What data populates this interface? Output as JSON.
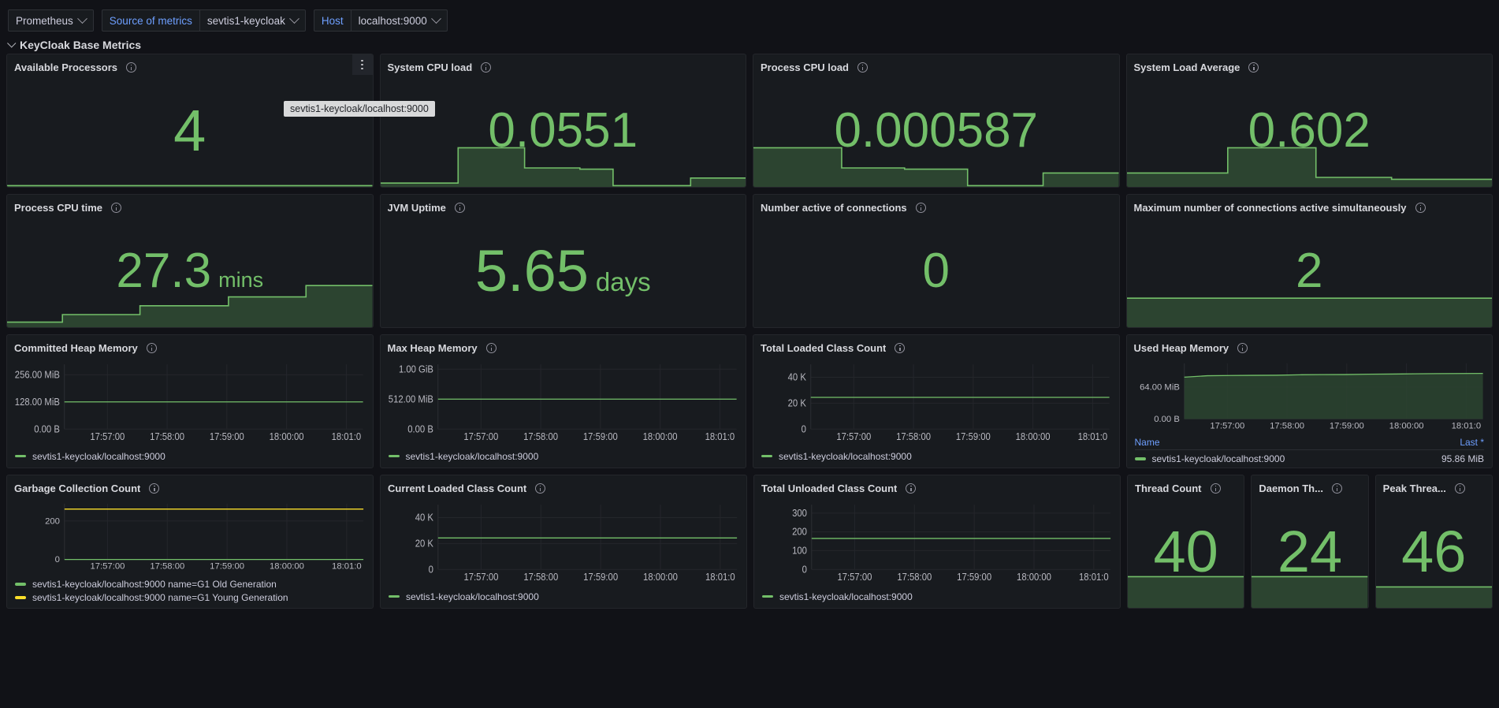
{
  "colors": {
    "green": "#73bf69",
    "green_fill": "#2c4430",
    "yellow": "#fade2a",
    "accent_blue": "#6e9fff",
    "panel_bg": "#181b1f",
    "page_bg": "#111217"
  },
  "varbar": {
    "datasource": "Prometheus",
    "source_label": "Source of metrics",
    "source_value": "sevtis1-keycloak",
    "host_label": "Host",
    "host_value": "localhost:9000"
  },
  "row": {
    "title": "KeyCloak Base Metrics"
  },
  "tooltip": {
    "text": "sevtis1-keycloak/localhost:9000"
  },
  "series_label": "sevtis1-keycloak/localhost:9000",
  "stats": [
    {
      "title": "Available Processors",
      "value": "4",
      "unit": "",
      "size": "big",
      "has_menu": true,
      "sparkline": [
        0.02,
        0.02,
        0.02,
        0.02,
        0.02,
        0.02,
        0.02,
        0.02,
        0.02,
        0.02,
        0.02,
        0.02,
        0.02,
        0.02,
        0.02,
        0.02,
        0.02,
        0.02,
        0.02,
        0.02
      ]
    },
    {
      "title": "System CPU load",
      "value": "0.0551",
      "unit": "",
      "size": "normal",
      "has_menu": false,
      "sparkline": [
        0.06,
        0.06,
        0.06,
        0.06,
        0.06,
        0.06,
        0.06,
        0.62,
        0.62,
        0.62,
        0.62,
        0.62,
        0.62,
        0.3,
        0.3,
        0.3,
        0.3,
        0.3,
        0.28,
        0.28,
        0.28,
        0.02,
        0.02,
        0.02,
        0.02,
        0.02,
        0.02,
        0.02,
        0.14,
        0.14,
        0.14,
        0.14,
        0.14,
        0.14
      ]
    },
    {
      "title": "Process CPU load",
      "value": "0.000587",
      "unit": "",
      "size": "normal",
      "has_menu": false,
      "sparkline": [
        0.62,
        0.62,
        0.62,
        0.62,
        0.62,
        0.62,
        0.62,
        0.3,
        0.3,
        0.3,
        0.3,
        0.3,
        0.28,
        0.28,
        0.28,
        0.28,
        0.28,
        0.02,
        0.02,
        0.02,
        0.02,
        0.02,
        0.02,
        0.22,
        0.22,
        0.22,
        0.22,
        0.22,
        0.22,
        0.22
      ]
    },
    {
      "title": "System Load Average",
      "value": "0.602",
      "unit": "",
      "size": "normal",
      "has_menu": false,
      "sparkline": [
        0.22,
        0.22,
        0.22,
        0.22,
        0.22,
        0.22,
        0.22,
        0.22,
        0.62,
        0.62,
        0.62,
        0.62,
        0.62,
        0.62,
        0.62,
        0.15,
        0.15,
        0.15,
        0.15,
        0.15,
        0.15,
        0.12,
        0.12,
        0.12,
        0.12,
        0.12,
        0.12,
        0.12,
        0.12,
        0.12
      ]
    },
    {
      "title": "Process CPU time",
      "value": "27.3",
      "unit": "mins",
      "size": "normal",
      "has_menu": false,
      "sparkline": [
        0.08,
        0.08,
        0.08,
        0.08,
        0.08,
        0.2,
        0.2,
        0.2,
        0.2,
        0.2,
        0.2,
        0.2,
        0.34,
        0.34,
        0.34,
        0.34,
        0.34,
        0.34,
        0.34,
        0.34,
        0.48,
        0.48,
        0.48,
        0.48,
        0.48,
        0.48,
        0.48,
        0.66,
        0.66,
        0.66,
        0.66,
        0.66,
        0.66,
        0.66
      ]
    },
    {
      "title": "JVM Uptime",
      "value": "5.65",
      "unit": "days",
      "size": "big",
      "has_menu": false,
      "sparkline": []
    },
    {
      "title": "Number active of connections",
      "value": "0",
      "unit": "",
      "size": "normal",
      "has_menu": false,
      "sparkline": []
    },
    {
      "title": "Maximum number of connections active simultaneously",
      "value": "2",
      "unit": "",
      "size": "normal",
      "has_menu": false,
      "sparkline": [
        0.46,
        0.46,
        0.46,
        0.46,
        0.46,
        0.46,
        0.46,
        0.46,
        0.46,
        0.46,
        0.46,
        0.46,
        0.46,
        0.46,
        0.46,
        0.46,
        0.46,
        0.46,
        0.46,
        0.46
      ]
    },
    {
      "title": "Thread Count",
      "value": "40",
      "unit": "",
      "size": "big",
      "has_menu": false,
      "sparkline": [
        0.52,
        0.52,
        0.52,
        0.52,
        0.52,
        0.52,
        0.52,
        0.52,
        0.52,
        0.52,
        0.52,
        0.52,
        0.52,
        0.52,
        0.52,
        0.52,
        0.52,
        0.52,
        0.52,
        0.52
      ]
    },
    {
      "title": "Daemon Th...",
      "value": "24",
      "unit": "",
      "size": "big",
      "has_menu": false,
      "sparkline": [
        0.52,
        0.52,
        0.52,
        0.52,
        0.52,
        0.52,
        0.52,
        0.52,
        0.52,
        0.52,
        0.52,
        0.52,
        0.52,
        0.52,
        0.52,
        0.52,
        0.52,
        0.52,
        0.52,
        0.52
      ]
    },
    {
      "title": "Peak Threa...",
      "value": "46",
      "unit": "",
      "size": "big",
      "has_menu": false,
      "sparkline": [
        0.35,
        0.35,
        0.35,
        0.35,
        0.35,
        0.35,
        0.35,
        0.35,
        0.35,
        0.35,
        0.35,
        0.35,
        0.35,
        0.35,
        0.35,
        0.35,
        0.35,
        0.35,
        0.35,
        0.35
      ]
    }
  ],
  "chart_data": [
    {
      "id": "committed-heap-memory",
      "type": "line",
      "title": "Committed Heap Memory",
      "xlabel": "",
      "ylabel": "",
      "grid": true,
      "legend_position": "bottom",
      "ytick_labels": [
        "256.00 MiB",
        "128.00 MiB",
        "0.00 B"
      ],
      "ytick_values": [
        268435456,
        134217728,
        0
      ],
      "ylim": [
        0,
        320000000
      ],
      "xtick_labels": [
        "17:57:00",
        "17:58:00",
        "17:59:00",
        "18:00:00",
        "18:01:0"
      ],
      "series": [
        {
          "name": "sevtis1-keycloak/localhost:9000",
          "color": "#73bf69",
          "fill": false,
          "values": [
            134217728,
            134217728,
            134217728,
            134217728,
            134217728,
            134217728,
            134217728,
            134217728,
            134217728,
            134217728
          ]
        }
      ]
    },
    {
      "id": "max-heap-memory",
      "type": "line",
      "title": "Max Heap Memory",
      "xlabel": "",
      "ylabel": "",
      "grid": true,
      "legend_position": "bottom",
      "ytick_labels": [
        "1.00 GiB",
        "512.00 MiB",
        "0.00 B"
      ],
      "ytick_values": [
        1073741824,
        536870912,
        0
      ],
      "ylim": [
        0,
        1160000000
      ],
      "xtick_labels": [
        "17:57:00",
        "17:58:00",
        "17:59:00",
        "18:00:00",
        "18:01:0"
      ],
      "series": [
        {
          "name": "sevtis1-keycloak/localhost:9000",
          "color": "#73bf69",
          "fill": false,
          "values": [
            536870912,
            536870912,
            536870912,
            536870912,
            536870912,
            536870912,
            536870912,
            536870912,
            536870912,
            536870912
          ]
        }
      ]
    },
    {
      "id": "total-loaded-class-count",
      "type": "line",
      "title": "Total Loaded Class Count",
      "xlabel": "",
      "ylabel": "",
      "grid": true,
      "legend_position": "bottom",
      "ytick_labels": [
        "40 K",
        "20 K",
        "0"
      ],
      "ytick_values": [
        40000,
        20000,
        0
      ],
      "ylim": [
        0,
        50000
      ],
      "xtick_labels": [
        "17:57:00",
        "17:58:00",
        "17:59:00",
        "18:00:00",
        "18:01:0"
      ],
      "series": [
        {
          "name": "sevtis1-keycloak/localhost:9000",
          "color": "#73bf69",
          "fill": false,
          "values": [
            24500,
            24500,
            24500,
            24500,
            24500,
            24500,
            24500,
            24500,
            24500,
            24500
          ]
        }
      ]
    },
    {
      "id": "used-heap-memory",
      "type": "area",
      "title": "Used Heap Memory",
      "xlabel": "",
      "ylabel": "",
      "grid": true,
      "legend_position": "bottom-table",
      "ytick_labels": [
        "64.00 MiB",
        "0.00 B"
      ],
      "ytick_values": [
        67108864,
        0
      ],
      "ylim": [
        0,
        117000000
      ],
      "xtick_labels": [
        "17:57:00",
        "17:58:00",
        "17:59:00",
        "18:00:00",
        "18:01:0"
      ],
      "legend_table": {
        "name_header": "Name",
        "value_header": "Last *"
      },
      "series": [
        {
          "name": "sevtis1-keycloak/localhost:9000",
          "color": "#73bf69",
          "fill": true,
          "last": "95.86 MiB",
          "values": [
            88000000,
            91000000,
            91500000,
            91800000,
            92000000,
            93000000,
            93300000,
            93500000,
            94200000,
            94500000,
            95000000,
            95400000,
            95600000,
            95860000
          ]
        }
      ]
    },
    {
      "id": "garbage-collection-count",
      "type": "line",
      "title": "Garbage Collection Count",
      "xlabel": "",
      "ylabel": "",
      "grid": true,
      "legend_position": "bottom",
      "ytick_labels": [
        "200",
        "0"
      ],
      "ytick_values": [
        200,
        0
      ],
      "ylim": [
        0,
        290
      ],
      "xtick_labels": [
        "17:57:00",
        "17:58:00",
        "17:59:00",
        "18:00:00",
        "18:01:0"
      ],
      "series": [
        {
          "name": "sevtis1-keycloak/localhost:9000 name=G1 Old Generation",
          "color": "#73bf69",
          "fill": false,
          "values": [
            0,
            0,
            0,
            0,
            0,
            0,
            0,
            0,
            0,
            0
          ]
        },
        {
          "name": "sevtis1-keycloak/localhost:9000 name=G1 Young Generation",
          "color": "#fade2a",
          "fill": false,
          "values": [
            262,
            262,
            262,
            262,
            262,
            262,
            262,
            262,
            262,
            262
          ]
        }
      ]
    },
    {
      "id": "current-loaded-class-count",
      "type": "line",
      "title": "Current Loaded Class Count",
      "xlabel": "",
      "ylabel": "",
      "grid": true,
      "legend_position": "bottom",
      "ytick_labels": [
        "40 K",
        "20 K",
        "0"
      ],
      "ytick_values": [
        40000,
        20000,
        0
      ],
      "ylim": [
        0,
        50000
      ],
      "xtick_labels": [
        "17:57:00",
        "17:58:00",
        "17:59:00",
        "18:00:00",
        "18:01:0"
      ],
      "series": [
        {
          "name": "sevtis1-keycloak/localhost:9000",
          "color": "#73bf69",
          "fill": false,
          "values": [
            24300,
            24300,
            24300,
            24300,
            24300,
            24300,
            24300,
            24300,
            24300,
            24300
          ]
        }
      ]
    },
    {
      "id": "total-unloaded-class-count",
      "type": "line",
      "title": "Total Unloaded Class Count",
      "xlabel": "",
      "ylabel": "",
      "grid": true,
      "legend_position": "bottom",
      "ytick_labels": [
        "300",
        "200",
        "100",
        "0"
      ],
      "ytick_values": [
        300,
        200,
        100,
        0
      ],
      "ylim": [
        0,
        345
      ],
      "xtick_labels": [
        "17:57:00",
        "17:58:00",
        "17:59:00",
        "18:00:00",
        "18:01:0"
      ],
      "series": [
        {
          "name": "sevtis1-keycloak/localhost:9000",
          "color": "#73bf69",
          "fill": false,
          "values": [
            165,
            165,
            165,
            165,
            165,
            165,
            165,
            165,
            165,
            165
          ]
        }
      ]
    }
  ]
}
